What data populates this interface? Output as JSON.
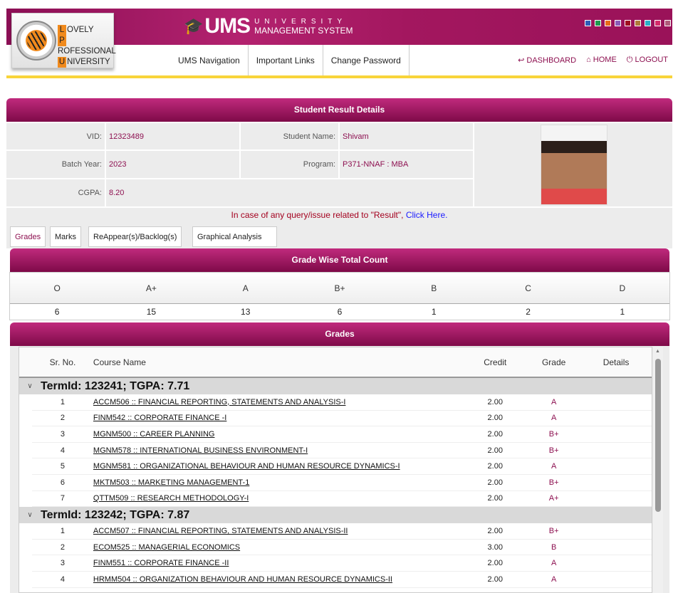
{
  "header": {
    "logo": {
      "l": "L",
      "ovely": "OVELY",
      "p": "P",
      "rofessional": "ROFESSIONAL",
      "u": "U",
      "niversity": "NIVERSITY"
    },
    "app_title": {
      "ums": "UMS",
      "university": "UNIVERSITY",
      "management": "MANAGEMENT SYSTEM"
    },
    "theme_colors": [
      "#2e5cb8",
      "#1f9a4e",
      "#e86a1a",
      "#8a5bb8",
      "#a01020",
      "#b07a3a",
      "#2ab0c8",
      "#d42a6a",
      "#b05a7a"
    ],
    "nav": [
      "UMS Navigation",
      "Important Links",
      "Change Password"
    ],
    "right_nav": [
      {
        "icon": "dashboard-icon",
        "label": "DASHBOARD"
      },
      {
        "icon": "home-icon",
        "label": "HOME"
      },
      {
        "icon": "logout-icon",
        "label": "LOGOUT"
      }
    ]
  },
  "student": {
    "title": "Student Result Details",
    "vid_label": "VID:",
    "vid": "12323489",
    "name_label": "Student Name:",
    "name": "Shivam",
    "batch_label": "Batch Year:",
    "batch": "2023",
    "program_label": "Program:",
    "program": "P371-NNAF : MBA",
    "cgpa_label": "CGPA:",
    "cgpa": "8.20",
    "query_text": "In case of any query/issue related to \"Result\", ",
    "query_link": "Click Here",
    "query_end": "."
  },
  "tabs": [
    "Grades",
    "Marks",
    "ReAppear(s)/Backlog(s)",
    "Graphical Analysis"
  ],
  "grade_count": {
    "title": "Grade Wise Total Count",
    "grades": [
      "O",
      "A+",
      "A",
      "B+",
      "B",
      "C",
      "D"
    ],
    "counts": [
      "6",
      "15",
      "13",
      "6",
      "1",
      "2",
      "1"
    ]
  },
  "grades": {
    "title": "Grades",
    "columns": [
      "Sr. No.",
      "Course Name",
      "Credit",
      "Grade",
      "Details"
    ],
    "terms": [
      {
        "label": "TermId: 123241; TGPA: 7.71",
        "rows": [
          {
            "sr": "1",
            "course": "ACCM506 :: FINANCIAL REPORTING, STATEMENTS AND ANALYSIS-I",
            "credit": "2.00",
            "grade": "A"
          },
          {
            "sr": "2",
            "course": "FINM542 :: CORPORATE FINANCE -I",
            "credit": "2.00",
            "grade": "A"
          },
          {
            "sr": "3",
            "course": "MGNM500 :: CAREER PLANNING",
            "credit": "2.00",
            "grade": "B+"
          },
          {
            "sr": "4",
            "course": "MGNM578 :: INTERNATIONAL BUSINESS ENVIRONMENT-I",
            "credit": "2.00",
            "grade": "B+"
          },
          {
            "sr": "5",
            "course": "MGNM581 :: ORGANIZATIONAL BEHAVIOUR AND HUMAN RESOURCE DYNAMICS-I",
            "credit": "2.00",
            "grade": "A"
          },
          {
            "sr": "6",
            "course": "MKTM503 :: MARKETING MANAGEMENT-1",
            "credit": "2.00",
            "grade": "B+"
          },
          {
            "sr": "7",
            "course": "QTTM509 :: RESEARCH METHODOLOGY-I",
            "credit": "2.00",
            "grade": "A+"
          }
        ]
      },
      {
        "label": "TermId: 123242; TGPA: 7.87",
        "rows": [
          {
            "sr": "1",
            "course": "ACCM507 :: FINANCIAL REPORTING, STATEMENTS AND ANALYSIS-II",
            "credit": "2.00",
            "grade": "B+"
          },
          {
            "sr": "2",
            "course": "ECOM525 :: MANAGERIAL ECONOMICS",
            "credit": "3.00",
            "grade": "B"
          },
          {
            "sr": "3",
            "course": "FINM551 :: CORPORATE FINANCE -II",
            "credit": "2.00",
            "grade": "A"
          },
          {
            "sr": "4",
            "course": "HRMM504 :: ORGANIZATION BEHAVIOUR AND HUMAN RESOURCE DYNAMICS-II",
            "credit": "2.00",
            "grade": "A"
          }
        ]
      }
    ]
  }
}
